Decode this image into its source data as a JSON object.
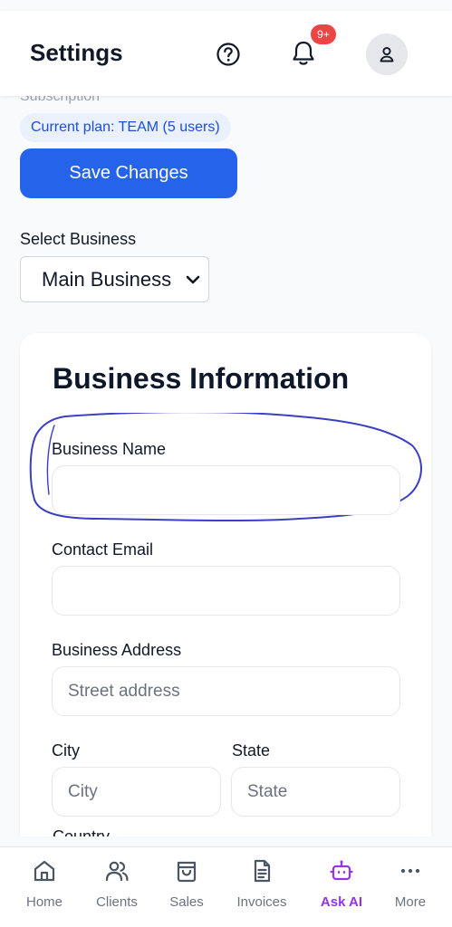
{
  "header": {
    "title": "Settings",
    "notification_badge": "9+",
    "icons": [
      "help-icon",
      "bell-icon",
      "user-icon"
    ]
  },
  "subscription": {
    "cut_label": "Subscription",
    "plan_text": "Current plan: TEAM (5 users)"
  },
  "save_label": "Save Changes",
  "business_select": {
    "label": "Select Business",
    "selected": "Main Business"
  },
  "form": {
    "title": "Business Information",
    "business_name": {
      "label": "Business Name",
      "value": ""
    },
    "contact_email": {
      "label": "Contact Email",
      "value": ""
    },
    "business_address": {
      "label": "Business Address",
      "placeholder": "Street address"
    },
    "city": {
      "label": "City",
      "placeholder": "City"
    },
    "state": {
      "label": "State",
      "placeholder": "State"
    },
    "country_cut": "Country"
  },
  "nav": {
    "items": [
      {
        "label": "Home",
        "icon": "home-icon"
      },
      {
        "label": "Clients",
        "icon": "users-icon"
      },
      {
        "label": "Sales",
        "icon": "shopping-bag-icon"
      },
      {
        "label": "Invoices",
        "icon": "document-icon"
      },
      {
        "label": "Ask AI",
        "icon": "robot-icon",
        "active": true
      },
      {
        "label": "More",
        "icon": "more-icon"
      }
    ]
  },
  "colors": {
    "primary": "#2563eb",
    "active_nav": "#9333ea",
    "badge": "#ef4444",
    "annotation": "#3b3fc4"
  }
}
